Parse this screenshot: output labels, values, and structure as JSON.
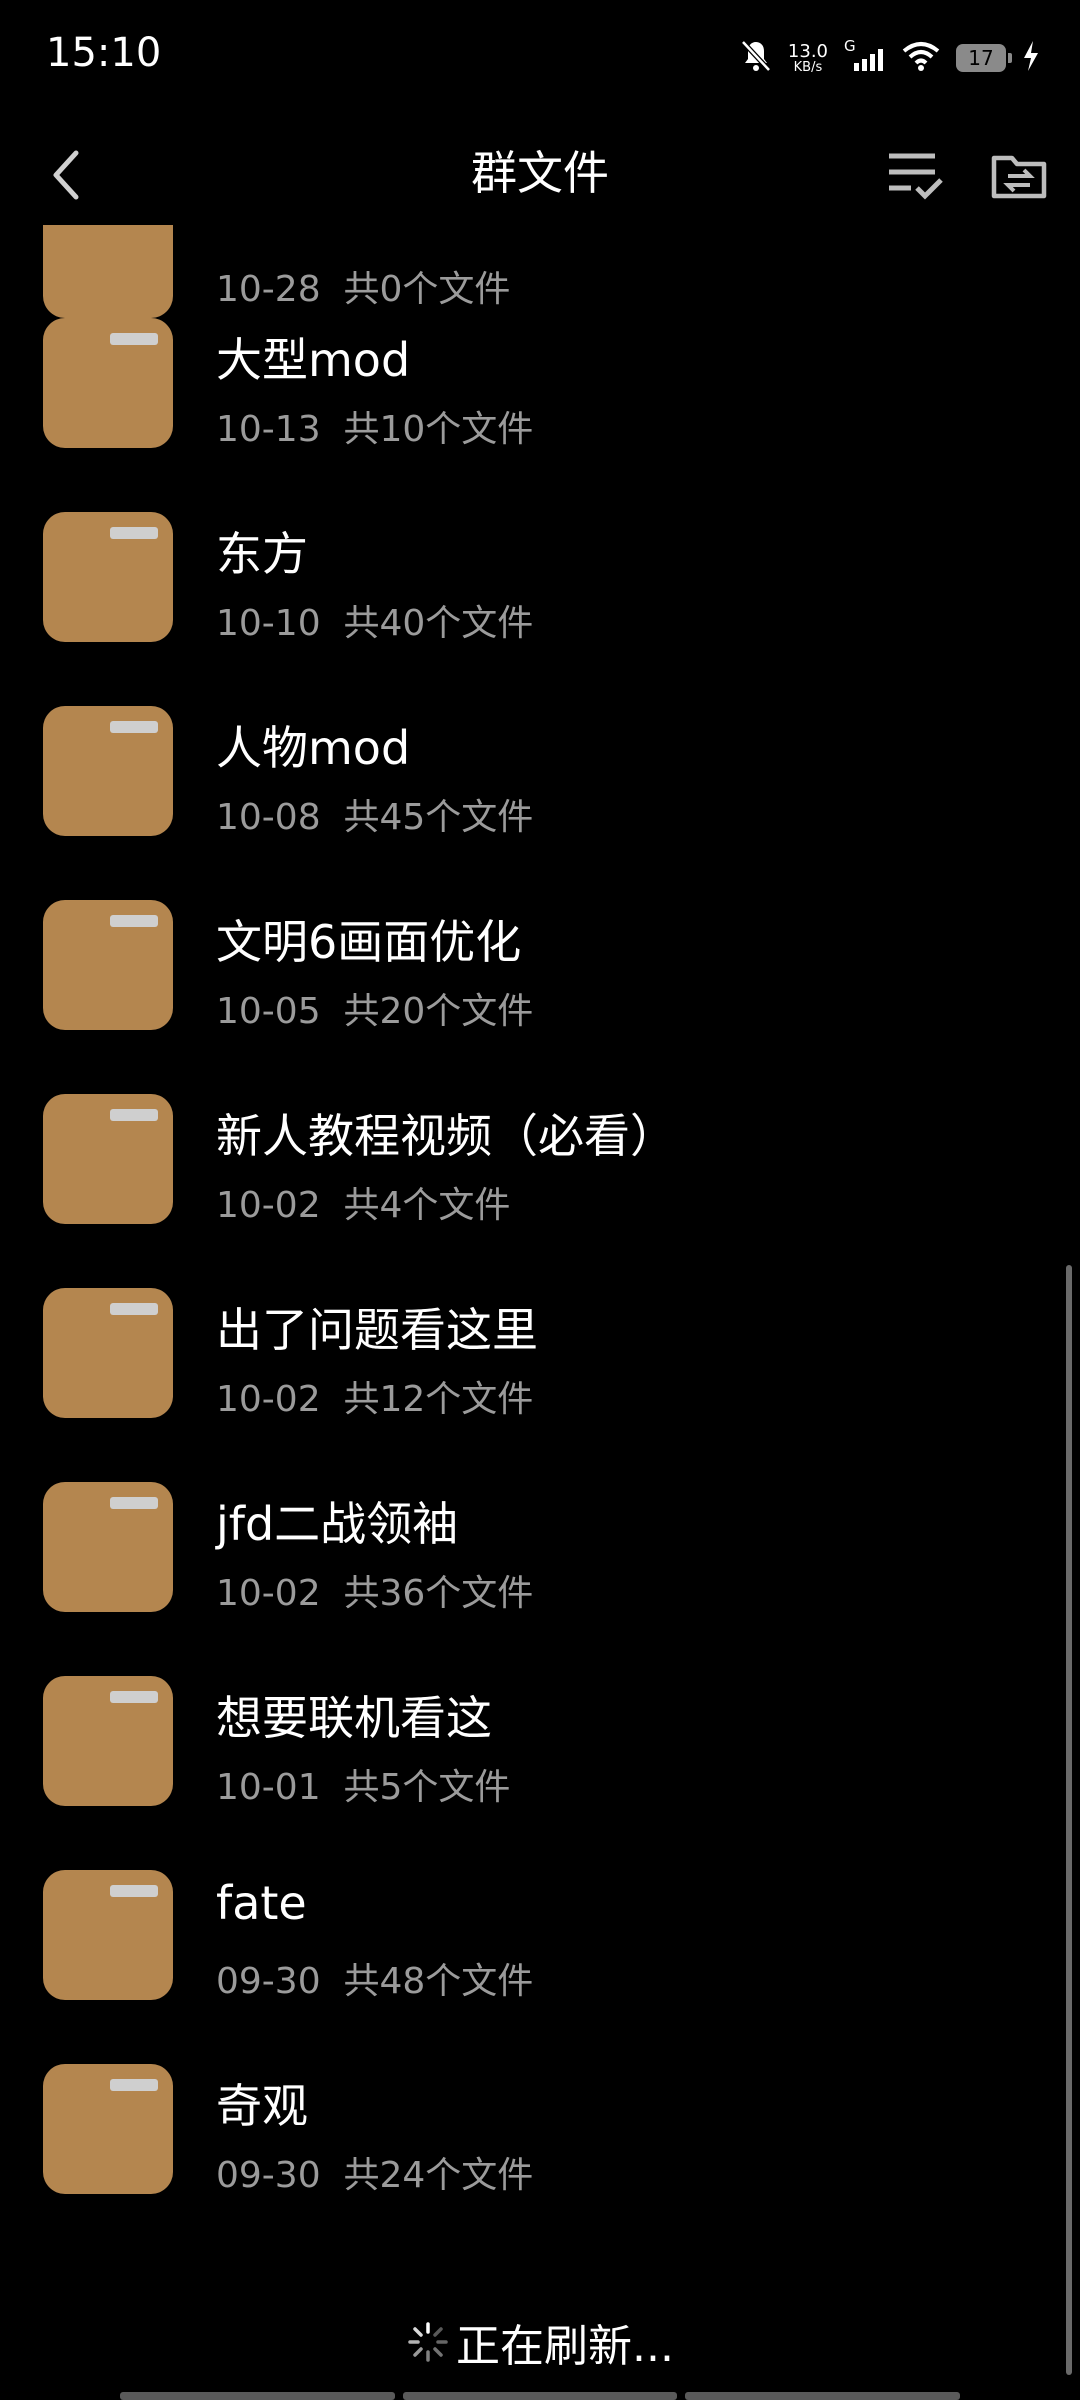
{
  "status_bar": {
    "time": "15:10",
    "net_speed_value": "13.0",
    "net_speed_unit": "KB/s",
    "signal_label": "G",
    "battery": "17"
  },
  "header": {
    "title": "群文件"
  },
  "folders": [
    {
      "name": "",
      "date": "10-28",
      "count": "共0个文件"
    },
    {
      "name": "大型mod",
      "date": "10-13",
      "count": "共10个文件"
    },
    {
      "name": "东方",
      "date": "10-10",
      "count": "共40个文件"
    },
    {
      "name": "人物mod",
      "date": "10-08",
      "count": "共45个文件"
    },
    {
      "name": "文明6画面优化",
      "date": "10-05",
      "count": "共20个文件"
    },
    {
      "name": "新人教程视频（必看）",
      "date": "10-02",
      "count": "共4个文件"
    },
    {
      "name": "出了问题看这里",
      "date": "10-02",
      "count": "共12个文件"
    },
    {
      "name": "jfd二战领袖",
      "date": "10-02",
      "count": "共36个文件"
    },
    {
      "name": "想要联机看这",
      "date": "10-01",
      "count": "共5个文件"
    },
    {
      "name": "fate",
      "date": "09-30",
      "count": "共48个文件"
    },
    {
      "name": "奇观",
      "date": "09-30",
      "count": "共24个文件"
    }
  ],
  "refresh_text": "正在刷新...",
  "colors": {
    "background": "#000000",
    "folder": "#b4864f",
    "meta_text": "#9b9b9b"
  },
  "icons": [
    "mute-bell-icon",
    "signal-icon",
    "wifi-icon",
    "battery-icon",
    "charging-icon",
    "back-icon",
    "sort-check-icon",
    "folder-switch-icon",
    "folder-icon",
    "spinner-icon"
  ]
}
